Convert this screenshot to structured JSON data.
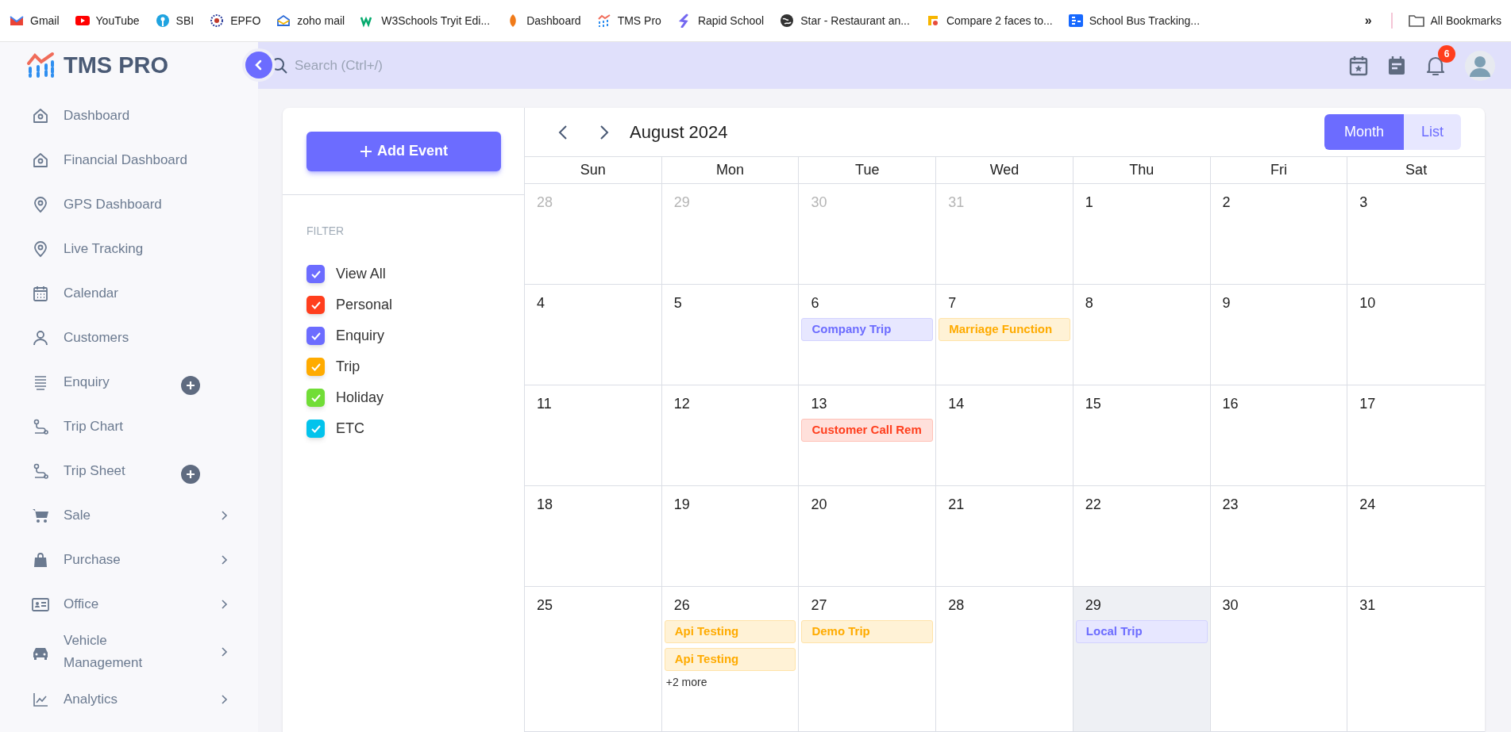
{
  "bookmarks": [
    {
      "label": "Gmail"
    },
    {
      "label": "YouTube"
    },
    {
      "label": "SBI"
    },
    {
      "label": "EPFO"
    },
    {
      "label": "zoho mail"
    },
    {
      "label": "W3Schools Tryit Edi..."
    },
    {
      "label": "Dashboard"
    },
    {
      "label": "TMS Pro"
    },
    {
      "label": "Rapid School"
    },
    {
      "label": "Star - Restaurant an..."
    },
    {
      "label": "Compare 2 faces to..."
    },
    {
      "label": "School Bus Tracking..."
    }
  ],
  "bookmarks_overflow": "»",
  "all_bookmarks": "All Bookmarks",
  "logo": {
    "text": "TMS PRO"
  },
  "sidebar": {
    "items": [
      {
        "label": "Dashboard",
        "kind": "plain"
      },
      {
        "label": "Financial Dashboard",
        "kind": "plain"
      },
      {
        "label": "GPS Dashboard",
        "kind": "plain"
      },
      {
        "label": "Live Tracking",
        "kind": "plain"
      },
      {
        "label": "Calendar",
        "kind": "plain"
      },
      {
        "label": "Customers",
        "kind": "plain"
      },
      {
        "label": "Enquiry",
        "kind": "add"
      },
      {
        "label": "Trip Chart",
        "kind": "plain"
      },
      {
        "label": "Trip Sheet",
        "kind": "add"
      },
      {
        "label": "Sale",
        "kind": "submenu"
      },
      {
        "label": "Purchase",
        "kind": "submenu"
      },
      {
        "label": "Office",
        "kind": "submenu"
      },
      {
        "label": "Vehicle Management",
        "kind": "submenu"
      },
      {
        "label": "Analytics",
        "kind": "submenu"
      }
    ]
  },
  "header": {
    "search": {
      "placeholder": "Search (Ctrl+/)"
    },
    "notification_count": "6"
  },
  "add_event_button": "Add Event",
  "filter": {
    "title": "FILTER",
    "items": [
      {
        "label": "View All",
        "checked": true,
        "color": "#6c6cff"
      },
      {
        "label": "Personal",
        "checked": true,
        "color": "#ff3e1d"
      },
      {
        "label": "Enquiry",
        "checked": true,
        "color": "#6c6cff"
      },
      {
        "label": "Trip",
        "checked": true,
        "color": "#ffab00"
      },
      {
        "label": "Holiday",
        "checked": true,
        "color": "#71dd37"
      },
      {
        "label": "ETC",
        "checked": true,
        "color": "#03c3ec"
      }
    ]
  },
  "calendar": {
    "title": "August 2024",
    "views": [
      {
        "label": "Month",
        "selected": true
      },
      {
        "label": "List",
        "selected": false
      }
    ],
    "weekdays": [
      "Sun",
      "Mon",
      "Tue",
      "Wed",
      "Thu",
      "Fri",
      "Sat"
    ],
    "weeks": [
      [
        {
          "day": "28",
          "muted": true,
          "today": false
        },
        {
          "day": "29",
          "muted": true,
          "today": false
        },
        {
          "day": "30",
          "muted": true,
          "today": false
        },
        {
          "day": "31",
          "muted": true,
          "today": false
        },
        {
          "day": "1",
          "muted": false,
          "today": false
        },
        {
          "day": "2",
          "muted": false,
          "today": false
        },
        {
          "day": "3",
          "muted": false,
          "today": false
        }
      ],
      [
        {
          "day": "4",
          "muted": false,
          "today": false
        },
        {
          "day": "5",
          "muted": false,
          "today": false
        },
        {
          "day": "6",
          "muted": false,
          "today": false,
          "events": [
            {
              "title": "Company Trip",
              "kind": "enquiry"
            }
          ]
        },
        {
          "day": "7",
          "muted": false,
          "today": false,
          "events": [
            {
              "title": "Marriage Function",
              "kind": "trip"
            }
          ]
        },
        {
          "day": "8",
          "muted": false,
          "today": false
        },
        {
          "day": "9",
          "muted": false,
          "today": false
        },
        {
          "day": "10",
          "muted": false,
          "today": false
        }
      ],
      [
        {
          "day": "11",
          "muted": false,
          "today": false
        },
        {
          "day": "12",
          "muted": false,
          "today": false
        },
        {
          "day": "13",
          "muted": false,
          "today": false,
          "events": [
            {
              "title": "Customer Call Rem",
              "kind": "personal"
            }
          ]
        },
        {
          "day": "14",
          "muted": false,
          "today": false
        },
        {
          "day": "15",
          "muted": false,
          "today": false
        },
        {
          "day": "16",
          "muted": false,
          "today": false
        },
        {
          "day": "17",
          "muted": false,
          "today": false
        }
      ],
      [
        {
          "day": "18",
          "muted": false,
          "today": false
        },
        {
          "day": "19",
          "muted": false,
          "today": false
        },
        {
          "day": "20",
          "muted": false,
          "today": false
        },
        {
          "day": "21",
          "muted": false,
          "today": false
        },
        {
          "day": "22",
          "muted": false,
          "today": false
        },
        {
          "day": "23",
          "muted": false,
          "today": false
        },
        {
          "day": "24",
          "muted": false,
          "today": false
        }
      ],
      [
        {
          "day": "25",
          "muted": false,
          "today": false
        },
        {
          "day": "26",
          "muted": false,
          "today": false,
          "events": [
            {
              "title": "Api Testing",
              "kind": "trip"
            },
            {
              "title": "Api Testing",
              "kind": "trip"
            }
          ],
          "more": "+2 more"
        },
        {
          "day": "27",
          "muted": false,
          "today": false,
          "events": [
            {
              "title": "Demo Trip",
              "kind": "trip"
            }
          ]
        },
        {
          "day": "28",
          "muted": false,
          "today": false
        },
        {
          "day": "29",
          "muted": false,
          "today": true,
          "events": [
            {
              "title": "Local Trip",
              "kind": "enquiry"
            }
          ]
        },
        {
          "day": "30",
          "muted": false,
          "today": false
        },
        {
          "day": "31",
          "muted": false,
          "today": false
        }
      ]
    ]
  }
}
